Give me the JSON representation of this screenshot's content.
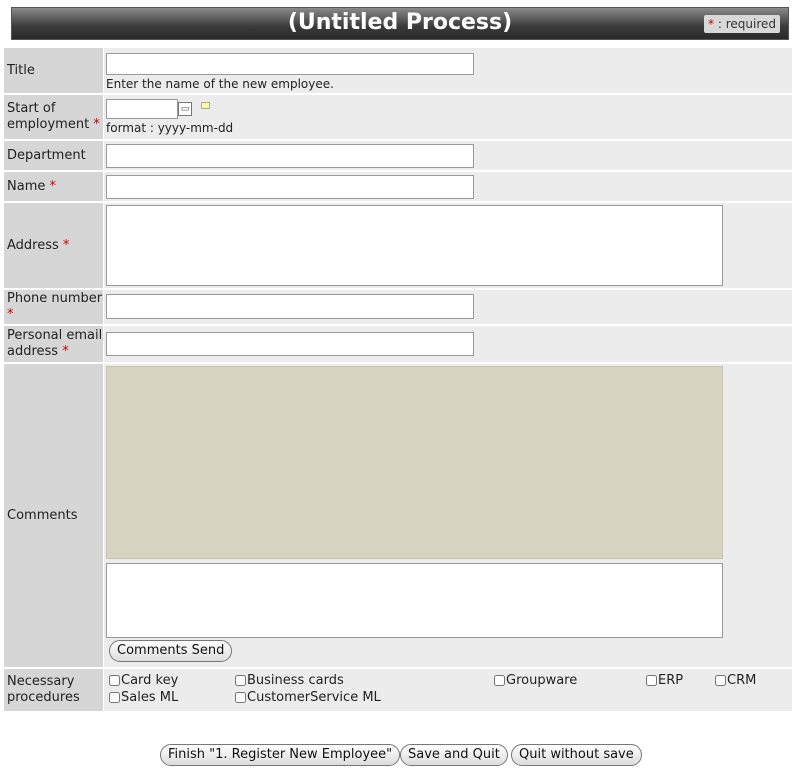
{
  "header": {
    "title": "(Untitled Process)",
    "required_star": "*",
    "required_text": " : required"
  },
  "fields": {
    "title": {
      "label": "Title",
      "value": "",
      "hint": "Enter the name of the new employee."
    },
    "start": {
      "label": "Start of employment",
      "required": "*",
      "value": "",
      "hint": "format : yyyy-mm-dd"
    },
    "department": {
      "label": "Department",
      "value": ""
    },
    "name": {
      "label": "Name",
      "required": "*",
      "value": ""
    },
    "address": {
      "label": "Address",
      "required": "*",
      "value": ""
    },
    "phone": {
      "label": "Phone number",
      "required": "*",
      "value": ""
    },
    "email": {
      "label": "Personal email address",
      "required": "*",
      "value": ""
    },
    "comments": {
      "label": "Comments",
      "value": "",
      "send_label": "Comments Send"
    },
    "procedures": {
      "label": "Necessary procedures",
      "options": [
        "Card key",
        "Business cards",
        "Groupware",
        "ERP",
        "CRM",
        "Sales ML",
        "CustomerService ML"
      ]
    }
  },
  "footer": {
    "finish_label": "Finish \"1. Register New Employee\"",
    "save_quit_label": "Save and Quit",
    "quit_nosave_label": "Quit without save"
  }
}
